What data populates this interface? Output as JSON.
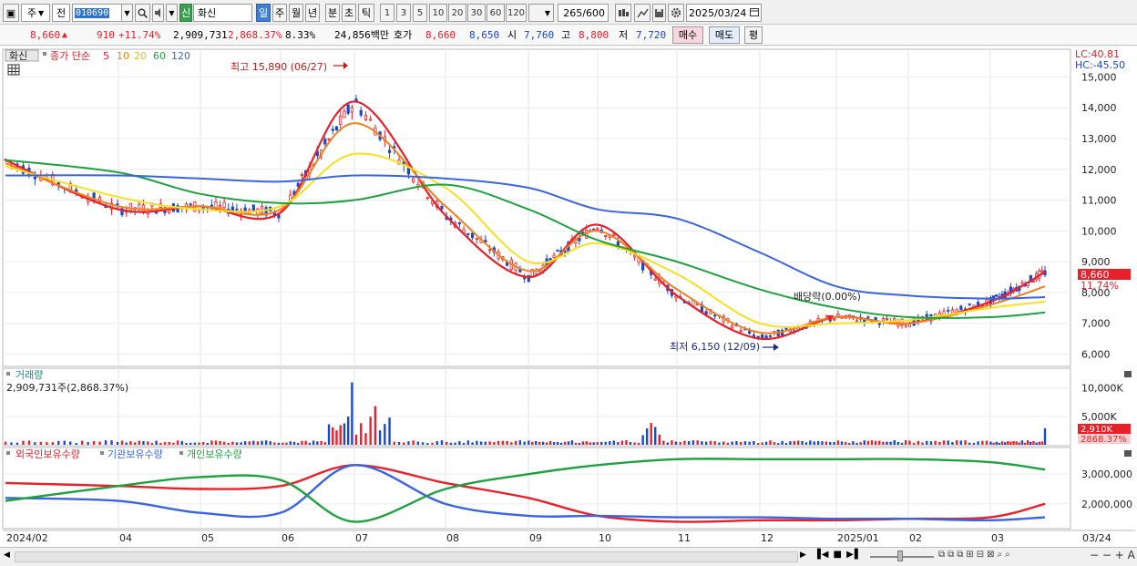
{
  "toolbar": {
    "period_label": "주",
    "prev_label": "전",
    "stock_code": "010690",
    "shin_badge": "신",
    "stock_name": "화신",
    "timeframes": [
      "일",
      "주",
      "월",
      "년",
      "분",
      "초",
      "틱"
    ],
    "active_timeframe": "일",
    "intervals": [
      "1",
      "3",
      "5",
      "10",
      "20",
      "30",
      "60",
      "120"
    ],
    "count": "265",
    "count_max": "/600",
    "date": "2025/03/24"
  },
  "quote": {
    "price": "8,660",
    "arrow": "▲",
    "change": "910",
    "change_pct": "+11.74%",
    "volume": "2,909,731",
    "volume_pct": "2,868.37%",
    "turnover": "8.33%",
    "amount": "24,856백만",
    "hoga_label": "호가",
    "hoga_ask": "8,660",
    "hoga_bid": "8,650",
    "open_label": "시",
    "open": "7,760",
    "high_label": "고",
    "high": "8,800",
    "low_label": "저",
    "low": "7,720",
    "buy_label": "매수",
    "sell_label": "매도",
    "eval_label": "평"
  },
  "price_panel": {
    "name_tag": "화신",
    "ma_title": "종가 단순",
    "ma_periods": [
      {
        "label": "5",
        "color": "#e8202a"
      },
      {
        "label": "10",
        "color": "#f08020"
      },
      {
        "label": "20",
        "color": "#f0e020"
      },
      {
        "label": "60",
        "color": "#20a040"
      },
      {
        "label": "120",
        "color": "#3a64e0"
      }
    ],
    "lc": "LC:40.81",
    "hc": "HC:-45.50",
    "high_annotation": "최고 15,890 (06/27)",
    "low_annotation": "최저 6,150 (12/09)",
    "dividend_annotation": "배당락(0.00%)",
    "last_price_tag": "8,660",
    "last_pct_tag": "11.74%",
    "y_ticks": [
      "15,000",
      "14,000",
      "13,000",
      "12,000",
      "11,000",
      "10,000",
      "9,000",
      "8,000",
      "7,000",
      "6,000"
    ]
  },
  "volume_panel": {
    "title": "거래량",
    "value_text": "2,909,731주(2,868.37%)",
    "y_ticks": [
      "10,000K",
      "5,000K"
    ],
    "last_tag": "2,910K",
    "last_pct_tag": "2868.37%"
  },
  "holder_panel": {
    "legends": [
      "외국인보유수량",
      "기관보유수량",
      "개인보유수량"
    ],
    "legend_colors": [
      "#e8202a",
      "#3a64e0",
      "#20a040"
    ],
    "y_ticks": [
      "3,000,000",
      "2,000,000"
    ]
  },
  "x_axis_labels": [
    "2024/02",
    "04",
    "05",
    "06",
    "07",
    "08",
    "09",
    "10",
    "11",
    "12",
    "2025/01",
    "02",
    "03",
    "03/24"
  ],
  "chart_data": [
    {
      "type": "line",
      "title": "",
      "ylabel": "",
      "ylim": [
        5600,
        15900
      ],
      "x": [
        "2024/02",
        "04",
        "05",
        "06",
        "07",
        "08",
        "09",
        "10",
        "11",
        "12",
        "2025/01",
        "02",
        "03",
        "03/24"
      ],
      "series": [
        {
          "name": "5",
          "values": [
            12300,
            10700,
            10800,
            10600,
            14200,
            10500,
            8500,
            10200,
            7900,
            6500,
            7200,
            7000,
            7700,
            8660
          ]
        },
        {
          "name": "10",
          "values": [
            12200,
            10800,
            10800,
            10700,
            13500,
            10800,
            8700,
            10000,
            8100,
            6700,
            7200,
            7000,
            7600,
            8200
          ]
        },
        {
          "name": "20",
          "values": [
            12100,
            11100,
            10700,
            10800,
            12500,
            11400,
            9000,
            9600,
            8600,
            7000,
            7000,
            7100,
            7500,
            7700
          ]
        },
        {
          "name": "60",
          "values": [
            12300,
            11900,
            11200,
            10900,
            11000,
            11500,
            10700,
            9700,
            9000,
            8100,
            7500,
            7200,
            7200,
            7350
          ]
        },
        {
          "name": "120",
          "values": [
            11800,
            11800,
            11700,
            11600,
            11800,
            11700,
            11400,
            10700,
            10400,
            9300,
            8200,
            7900,
            7800,
            7850
          ]
        }
      ]
    },
    {
      "type": "line",
      "title": "",
      "ylabel": "",
      "ylim": [
        1200000,
        3800000
      ],
      "x": [
        "2024/02",
        "04",
        "05",
        "06",
        "07",
        "08",
        "09",
        "10",
        "11",
        "12",
        "2025/01",
        "02",
        "03",
        "03/24"
      ],
      "series": [
        {
          "name": "외국인보유수량",
          "values": [
            2700000,
            2600000,
            2500000,
            2600000,
            3300000,
            2700000,
            2200000,
            1600000,
            1400000,
            1450000,
            1450000,
            1500000,
            1550000,
            2000000
          ]
        },
        {
          "name": "기관보유수량",
          "values": [
            2200000,
            2100000,
            1700000,
            1700000,
            3300000,
            2000000,
            1600000,
            1600000,
            1550000,
            1550000,
            1500000,
            1500000,
            1450000,
            1550000
          ]
        },
        {
          "name": "개인보유수량",
          "values": [
            2100000,
            2600000,
            2900000,
            2800000,
            1400000,
            2500000,
            3000000,
            3300000,
            3500000,
            3500000,
            3500000,
            3500000,
            3400000,
            3150000
          ]
        }
      ]
    }
  ]
}
